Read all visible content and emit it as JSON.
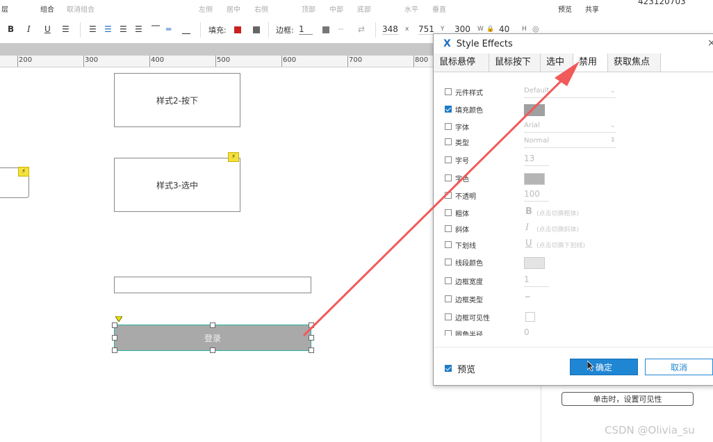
{
  "topbar": {
    "layer": "层",
    "group": "组合",
    "ungroup": "取消组合",
    "align_left": "左侧",
    "align_center": "居中",
    "align_right": "右侧",
    "align_top": "顶部",
    "align_middle": "中部",
    "align_bottom": "底部",
    "dist_h": "水平",
    "dist_v": "垂直",
    "preview": "预览",
    "share": "共享",
    "project_id": "423120703"
  },
  "toolbar": {
    "bold": "B",
    "italic": "I",
    "underline": "U",
    "fill_label": "填充:",
    "fill_color": "#cc1f1f",
    "border_label": "边框:",
    "border_width": "1",
    "x_value": "348",
    "x_label": "x",
    "y_value": "751",
    "y_label": "Y",
    "w_value": "300",
    "w_label": "W",
    "h_value": "40",
    "h_label": "H"
  },
  "ruler": {
    "labels": [
      "200",
      "300",
      "400",
      "500",
      "600",
      "700",
      "800"
    ]
  },
  "canvas": {
    "shape_style2": "样式2-按下",
    "shape_style3": "样式3-选中",
    "login_button": "登录",
    "flag_glyph": "⚡"
  },
  "right_panel": {
    "button_visible": "单击时，设置可见性"
  },
  "dialog": {
    "title": "Style Effects",
    "close": "×",
    "tabs": [
      "鼠标悬停",
      "鼠标按下",
      "选中",
      "禁用",
      "获取焦点"
    ],
    "properties": [
      {
        "label": "元件样式",
        "value": "Default",
        "checked": false
      },
      {
        "label": "填充颜色",
        "value": "",
        "checked": true
      },
      {
        "label": "字体",
        "value": "Arial",
        "checked": false
      },
      {
        "label": "类型",
        "value": "Normal",
        "checked": false
      },
      {
        "label": "字号",
        "value": "13",
        "checked": false
      },
      {
        "label": "字色",
        "value": "",
        "checked": false
      },
      {
        "label": "不透明",
        "value": "100",
        "checked": false
      },
      {
        "label": "粗体",
        "value": "(点击切换粗体)",
        "checked": false
      },
      {
        "label": "斜体",
        "value": "(点击切换斜体)",
        "checked": false
      },
      {
        "label": "下划线",
        "value": "(点击切换下划线)",
        "checked": false
      },
      {
        "label": "线段颜色",
        "value": "",
        "checked": false
      },
      {
        "label": "边框宽度",
        "value": "1",
        "checked": false
      },
      {
        "label": "边框类型",
        "value": "",
        "checked": false
      },
      {
        "label": "边框可见性",
        "value": "",
        "checked": false
      },
      {
        "label": "圆角半径",
        "value": "0",
        "checked": false
      }
    ],
    "preview_label": "预览",
    "ok": "确定",
    "cancel": "取消"
  },
  "watermark": "CSDN @Olivia_su",
  "colors": {
    "accent": "#1f86d4",
    "arrow": "#f05a5a",
    "login_fill": "#a9a9a9",
    "fill_swatch_disabled": "#a0a0a0"
  }
}
